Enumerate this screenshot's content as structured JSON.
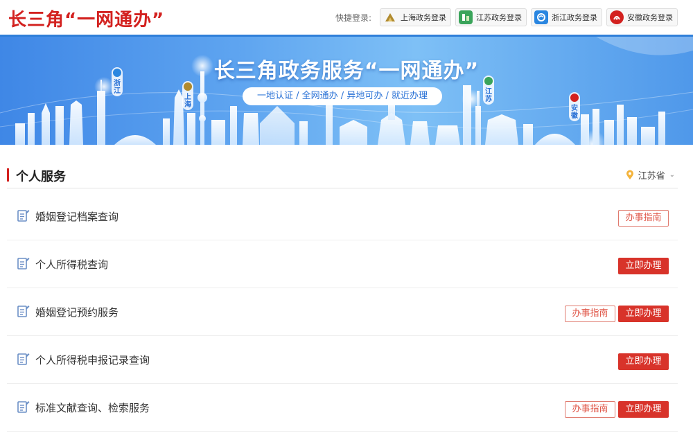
{
  "header": {
    "logo": "长三角“一网通办”",
    "quick_login_label": "快捷登录:",
    "quick_logins": [
      {
        "label": "上海政务登录",
        "icon": "shanghai-logo-icon",
        "color": "#b08a2e"
      },
      {
        "label": "江苏政务登录",
        "icon": "jiangsu-logo-icon",
        "color": "#3aa45a"
      },
      {
        "label": "浙江政务登录",
        "icon": "zhejiang-logo-icon",
        "color": "#2a86e0"
      },
      {
        "label": "安徽政务登录",
        "icon": "anhui-logo-icon",
        "color": "#d3211f"
      }
    ]
  },
  "banner": {
    "title": "长三角政务服务“一网通办”",
    "subtitle": "一地认证 / 全网通办 / 异地可办 / 就近办理",
    "markers": [
      "浙江",
      "上海",
      "江苏",
      "安徽"
    ]
  },
  "section": {
    "title": "个人服务",
    "region": "江苏省"
  },
  "buttons": {
    "guide": "办事指南",
    "do_now": "立即办理"
  },
  "services": [
    {
      "label": "婚姻登记档案查询",
      "guide": true,
      "do_now": false
    },
    {
      "label": "个人所得税查询",
      "guide": false,
      "do_now": true
    },
    {
      "label": "婚姻登记预约服务",
      "guide": true,
      "do_now": true
    },
    {
      "label": "个人所得税申报记录查询",
      "guide": false,
      "do_now": true
    },
    {
      "label": "标准文献查询、检索服务",
      "guide": true,
      "do_now": true
    }
  ],
  "colors": {
    "brand_red": "#d3211f",
    "primary_blue": "#2f7fd9"
  }
}
